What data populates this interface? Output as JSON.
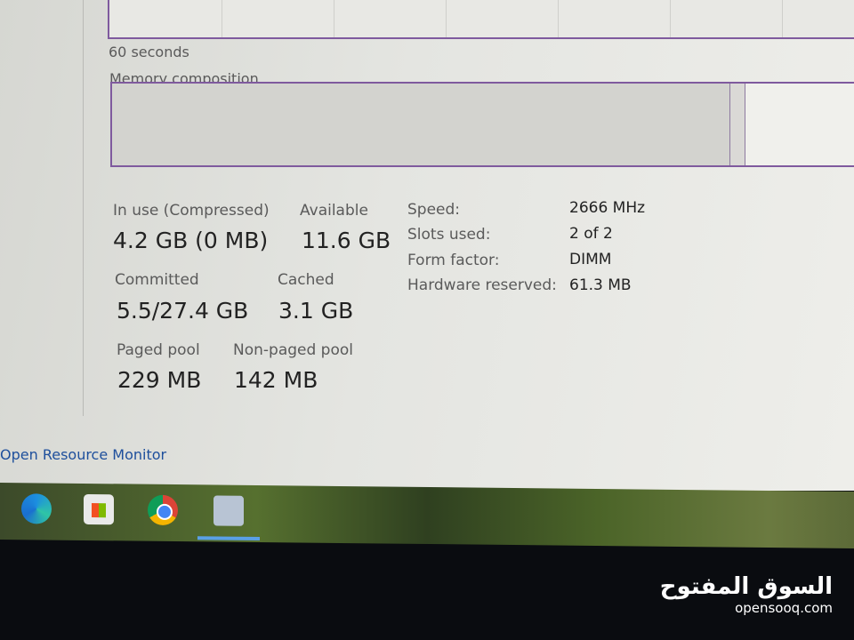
{
  "graph": {
    "time_label": "60 seconds"
  },
  "composition": {
    "title": "Memory composition"
  },
  "stats": {
    "in_use": {
      "label": "In use (Compressed)",
      "value": "4.2 GB (0 MB)"
    },
    "available": {
      "label": "Available",
      "value": "11.6 GB"
    },
    "committed": {
      "label": "Committed",
      "value": "5.5/27.4 GB"
    },
    "cached": {
      "label": "Cached",
      "value": "3.1 GB"
    },
    "paged_pool": {
      "label": "Paged pool",
      "value": "229 MB"
    },
    "non_paged_pool": {
      "label": "Non-paged pool",
      "value": "142 MB"
    }
  },
  "details": [
    {
      "label": "Speed:",
      "value": "2666 MHz"
    },
    {
      "label": "Slots used:",
      "value": "2 of 2"
    },
    {
      "label": "Form factor:",
      "value": "DIMM"
    },
    {
      "label": "Hardware reserved:",
      "value": "61.3 MB"
    }
  ],
  "link": {
    "open_resource_monitor": "Open Resource Monitor"
  },
  "taskbar": {
    "icons": [
      "edge-icon",
      "microsoft-store-icon",
      "chrome-icon",
      "task-manager-icon"
    ]
  },
  "watermark": {
    "arabic": "السوق المفتوح",
    "latin": "opensooq.com"
  },
  "colors": {
    "graph_border": "#7f5a9e",
    "link": "#1e4f9c"
  }
}
